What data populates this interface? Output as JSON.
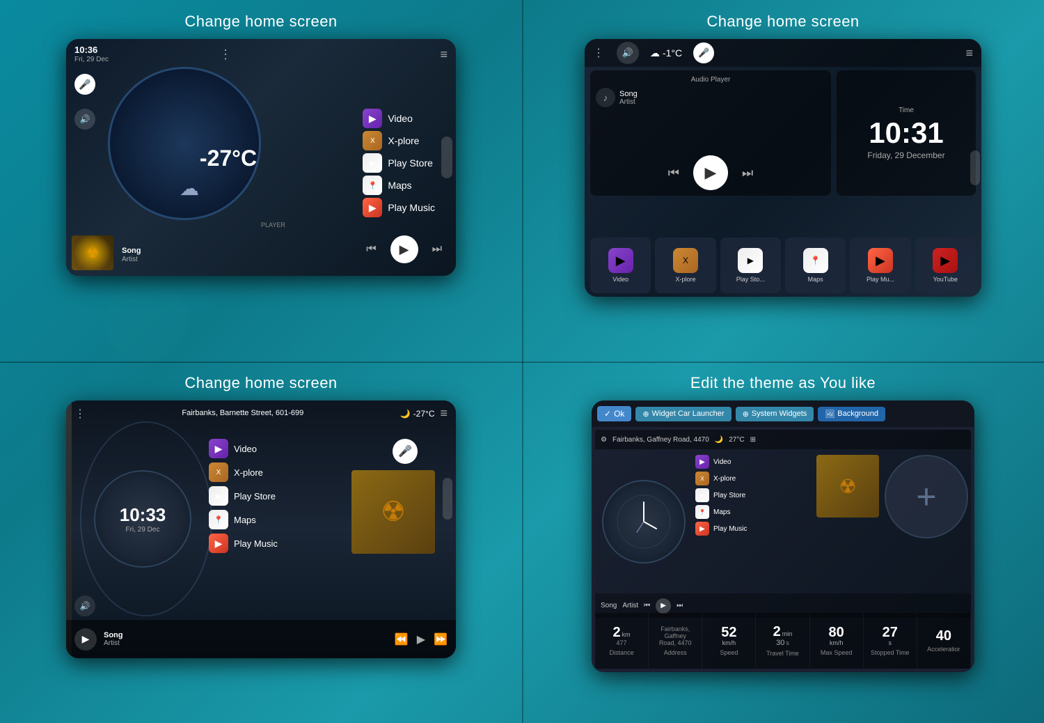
{
  "quadrant1": {
    "title": "Change home screen",
    "phone": {
      "time": "10:36",
      "date": "Fri, 29 Dec",
      "temp": "-27°C",
      "apps": [
        {
          "label": "Video",
          "icon": "▶",
          "iconClass": "icon-video"
        },
        {
          "label": "X-plore",
          "icon": "🔧",
          "iconClass": "icon-xplore"
        },
        {
          "label": "Play Store",
          "icon": "▶",
          "iconClass": "icon-playstore"
        },
        {
          "label": "Maps",
          "icon": "📍",
          "iconClass": "icon-maps"
        },
        {
          "label": "Play Music",
          "icon": "▶",
          "iconClass": "icon-playmusic"
        }
      ],
      "player": {
        "label": "Player",
        "song": "Song",
        "artist": "Artist"
      }
    }
  },
  "quadrant2": {
    "title": "Change home screen",
    "phone": {
      "temp": "-1°C",
      "time": "10:31",
      "date": "Friday, 29 December",
      "song": "Song",
      "artist": "Artist",
      "apps": [
        {
          "label": "Video",
          "iconClass": "icon-video"
        },
        {
          "label": "X-plore",
          "iconClass": "icon-xplore"
        },
        {
          "label": "Play Sto...",
          "iconClass": "icon-playstore"
        },
        {
          "label": "Maps",
          "iconClass": "icon-maps"
        },
        {
          "label": "Play Mu...",
          "iconClass": "icon-playmusic"
        },
        {
          "label": "YouTube",
          "iconClass": "icon-youtube"
        }
      ],
      "audioPlayerLabel": "Audio Player",
      "timeLabel": "Time"
    }
  },
  "quadrant3": {
    "title": "Change home screen",
    "phone": {
      "time": "10:33",
      "date": "Fri, 29 Dec",
      "address": "Fairbanks, Barnette Street, 601-699",
      "temp": "-27°C",
      "apps": [
        {
          "label": "Video",
          "iconClass": "icon-video"
        },
        {
          "label": "X-plore",
          "iconClass": "icon-xplore"
        },
        {
          "label": "Play Store",
          "iconClass": "icon-playstore"
        },
        {
          "label": "Maps",
          "iconClass": "icon-maps"
        },
        {
          "label": "Play Music",
          "iconClass": "icon-playmusic"
        }
      ],
      "song": "Song",
      "artist": "Artist"
    }
  },
  "quadrant4": {
    "title": "Edit the theme as You like",
    "phone": {
      "buttons": {
        "ok": "Ok",
        "widget": "Widget Car Launcher",
        "system": "System Widgets",
        "background": "Background"
      },
      "address": "Fairbanks, Gaffney Road, 4470",
      "temp": "27°C",
      "apps": [
        {
          "label": "Video"
        },
        {
          "label": "X-plore"
        },
        {
          "label": "Play Store"
        },
        {
          "label": "Maps"
        },
        {
          "label": "Play Music"
        }
      ],
      "song": "Song",
      "artist": "Artist",
      "stats": [
        {
          "value": "2",
          "sub": "477",
          "unit": "km",
          "label": "Distance"
        },
        {
          "value": "Fairbanks,",
          "sub": "Gaffney",
          "unit": "Road, 4470",
          "label": "Address"
        },
        {
          "value": "52",
          "unit": "km/h",
          "label": "Speed"
        },
        {
          "value": "2",
          "sub": "30",
          "unit": "min",
          "unit2": "s",
          "label": "Travel Time"
        },
        {
          "value": "80",
          "unit": "km/h",
          "label": "Max Speed"
        },
        {
          "value": "27",
          "unit": "s",
          "label": "Stopped Time"
        },
        {
          "value": "40",
          "unit": "",
          "label": "Acceleratior"
        }
      ]
    }
  }
}
